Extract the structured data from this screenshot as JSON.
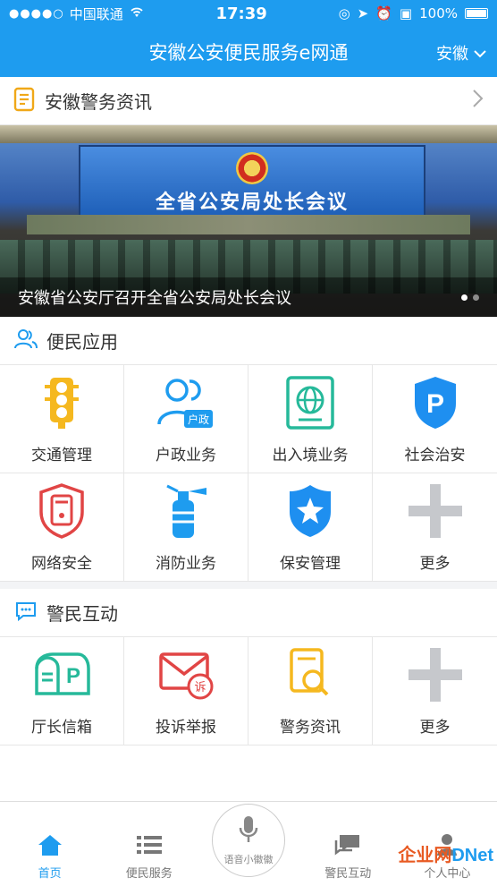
{
  "status": {
    "carrier": "中国联通",
    "time": "17:39",
    "battery": "100%"
  },
  "nav": {
    "title": "安徽公安便民服务e网通",
    "region": "安徽"
  },
  "news": {
    "label": "安徽警务资讯",
    "screen_text": "全省公安局处长会议",
    "caption": "安徽省公安厅召开全省公安局处长会议"
  },
  "services": {
    "label": "便民应用",
    "items": [
      {
        "label": "交通管理",
        "icon": "traffic-light-icon"
      },
      {
        "label": "户政业务",
        "icon": "household-icon",
        "badge": "户政"
      },
      {
        "label": "出入境业务",
        "icon": "globe-icon"
      },
      {
        "label": "社会治安",
        "icon": "parking-shield-icon",
        "glyph": "P"
      },
      {
        "label": "网络安全",
        "icon": "network-security-icon"
      },
      {
        "label": "消防业务",
        "icon": "fire-extinguisher-icon"
      },
      {
        "label": "保安管理",
        "icon": "star-shield-icon"
      },
      {
        "label": "更多",
        "icon": "plus-icon"
      }
    ]
  },
  "interaction": {
    "label": "警民互动",
    "items": [
      {
        "label": "厅长信箱",
        "icon": "mailbox-icon",
        "glyph": "P"
      },
      {
        "label": "投诉举报",
        "icon": "complaint-mail-icon",
        "badge": "诉"
      },
      {
        "label": "警务资讯",
        "icon": "search-doc-icon"
      },
      {
        "label": "更多",
        "icon": "plus-icon"
      }
    ]
  },
  "tabs": [
    {
      "label": "首页",
      "icon": "home-icon"
    },
    {
      "label": "便民服务",
      "icon": "list-icon"
    },
    {
      "label": "语音小徽徽",
      "icon": "microphone-icon"
    },
    {
      "label": "警民互动",
      "icon": "chat-icon"
    },
    {
      "label": "个人中心",
      "icon": "user-icon"
    }
  ],
  "watermark": {
    "a": "企业网",
    "b": "DNet"
  },
  "colors": {
    "primary": "#1e9cef"
  }
}
